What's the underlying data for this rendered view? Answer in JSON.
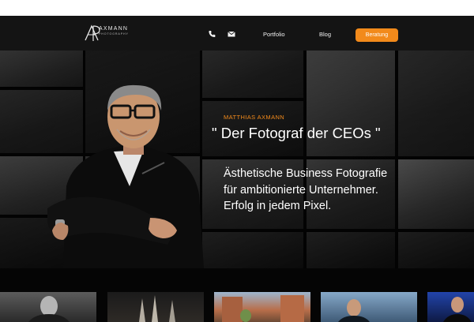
{
  "brand": {
    "name": "AXMANN",
    "subtitle": "PHOTOGRAPHY"
  },
  "nav": {
    "phone_icon": "phone-icon",
    "mail_icon": "mail-icon",
    "portfolio": "Portfolio",
    "blog": "Blog",
    "cta": "Beratung"
  },
  "hero": {
    "eyebrow": "MATTHIAS AXMANN",
    "headline": "\" Der Fotograf der CEOs \"",
    "tagline": [
      "Ästhetische Business Fotografie",
      "für ambitionierte Unternehmer.",
      "Erfolg in jedem Pixel."
    ]
  },
  "colors": {
    "accent": "#f28a1b",
    "background": "#050505",
    "nav_background": "#141414",
    "text": "#ffffff"
  }
}
